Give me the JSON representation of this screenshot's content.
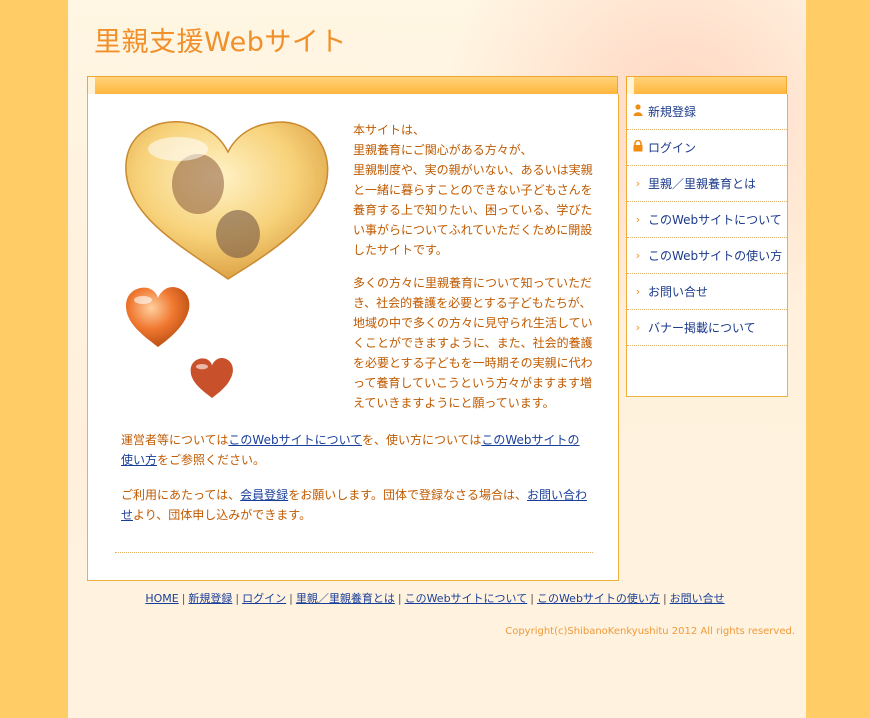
{
  "site": {
    "title": "里親支援Webサイト"
  },
  "sidebar": {
    "items": [
      {
        "label": "新規登録",
        "icon": "person-icon"
      },
      {
        "label": "ログイン",
        "icon": "lock-icon"
      },
      {
        "label": "里親／里親養育とは",
        "icon": "arrow-right-icon"
      },
      {
        "label": "このWebサイトについて",
        "icon": "arrow-right-icon"
      },
      {
        "label": "このWebサイトの使い方",
        "icon": "arrow-right-icon"
      },
      {
        "label": "お問い合せ",
        "icon": "arrow-right-icon"
      },
      {
        "label": "バナー掲載について",
        "icon": "arrow-right-icon"
      }
    ]
  },
  "main": {
    "intro": [
      "本サイトは、\n里親養育にご関心がある方々が、\n里親制度や、実の親がいない、あるいは実親と一緒に暮らすことのできない子どもさんを養育する上で知りたい、困っている、学びたい事がらについてふれていただくために開設したサイトです。",
      "多くの方々に里親養育について知っていただき、社会的養護を必要とする子どもたちが、地域の中で多くの方々に見守られ生活していくことができますように、また、社会的養護を必要とする子どもを一時期その実親に代わって養育していこうという方々がますます増えていきますようにと願っています。"
    ],
    "note1": {
      "pre": "運営者等については",
      "link1": "このWebサイトについて",
      "mid": "を、使い方については",
      "link2": "このWebサイトの使い方",
      "post": "をご参照ください。"
    },
    "note2": {
      "pre": "ご利用にあたっては、",
      "link1": "会員登録",
      "mid": "をお願いします。団体で登録なさる場合は、",
      "link2": "お問い合わせ",
      "post": "より、団体申し込みができます。"
    }
  },
  "footer": {
    "links": [
      "HOME",
      "新規登録",
      "ログイン",
      "里親／里親養育とは",
      "このWebサイトについて",
      "このWebサイトの使い方",
      "お問い合せ"
    ],
    "separator": "|",
    "copyright": "Copyright(c)ShibanoKenkyushitu 2012 All rights reserved."
  },
  "colors": {
    "accent": "#f0902a",
    "text": "#c05a00",
    "link": "#1a3f9a",
    "frame": "#ffcc66"
  }
}
